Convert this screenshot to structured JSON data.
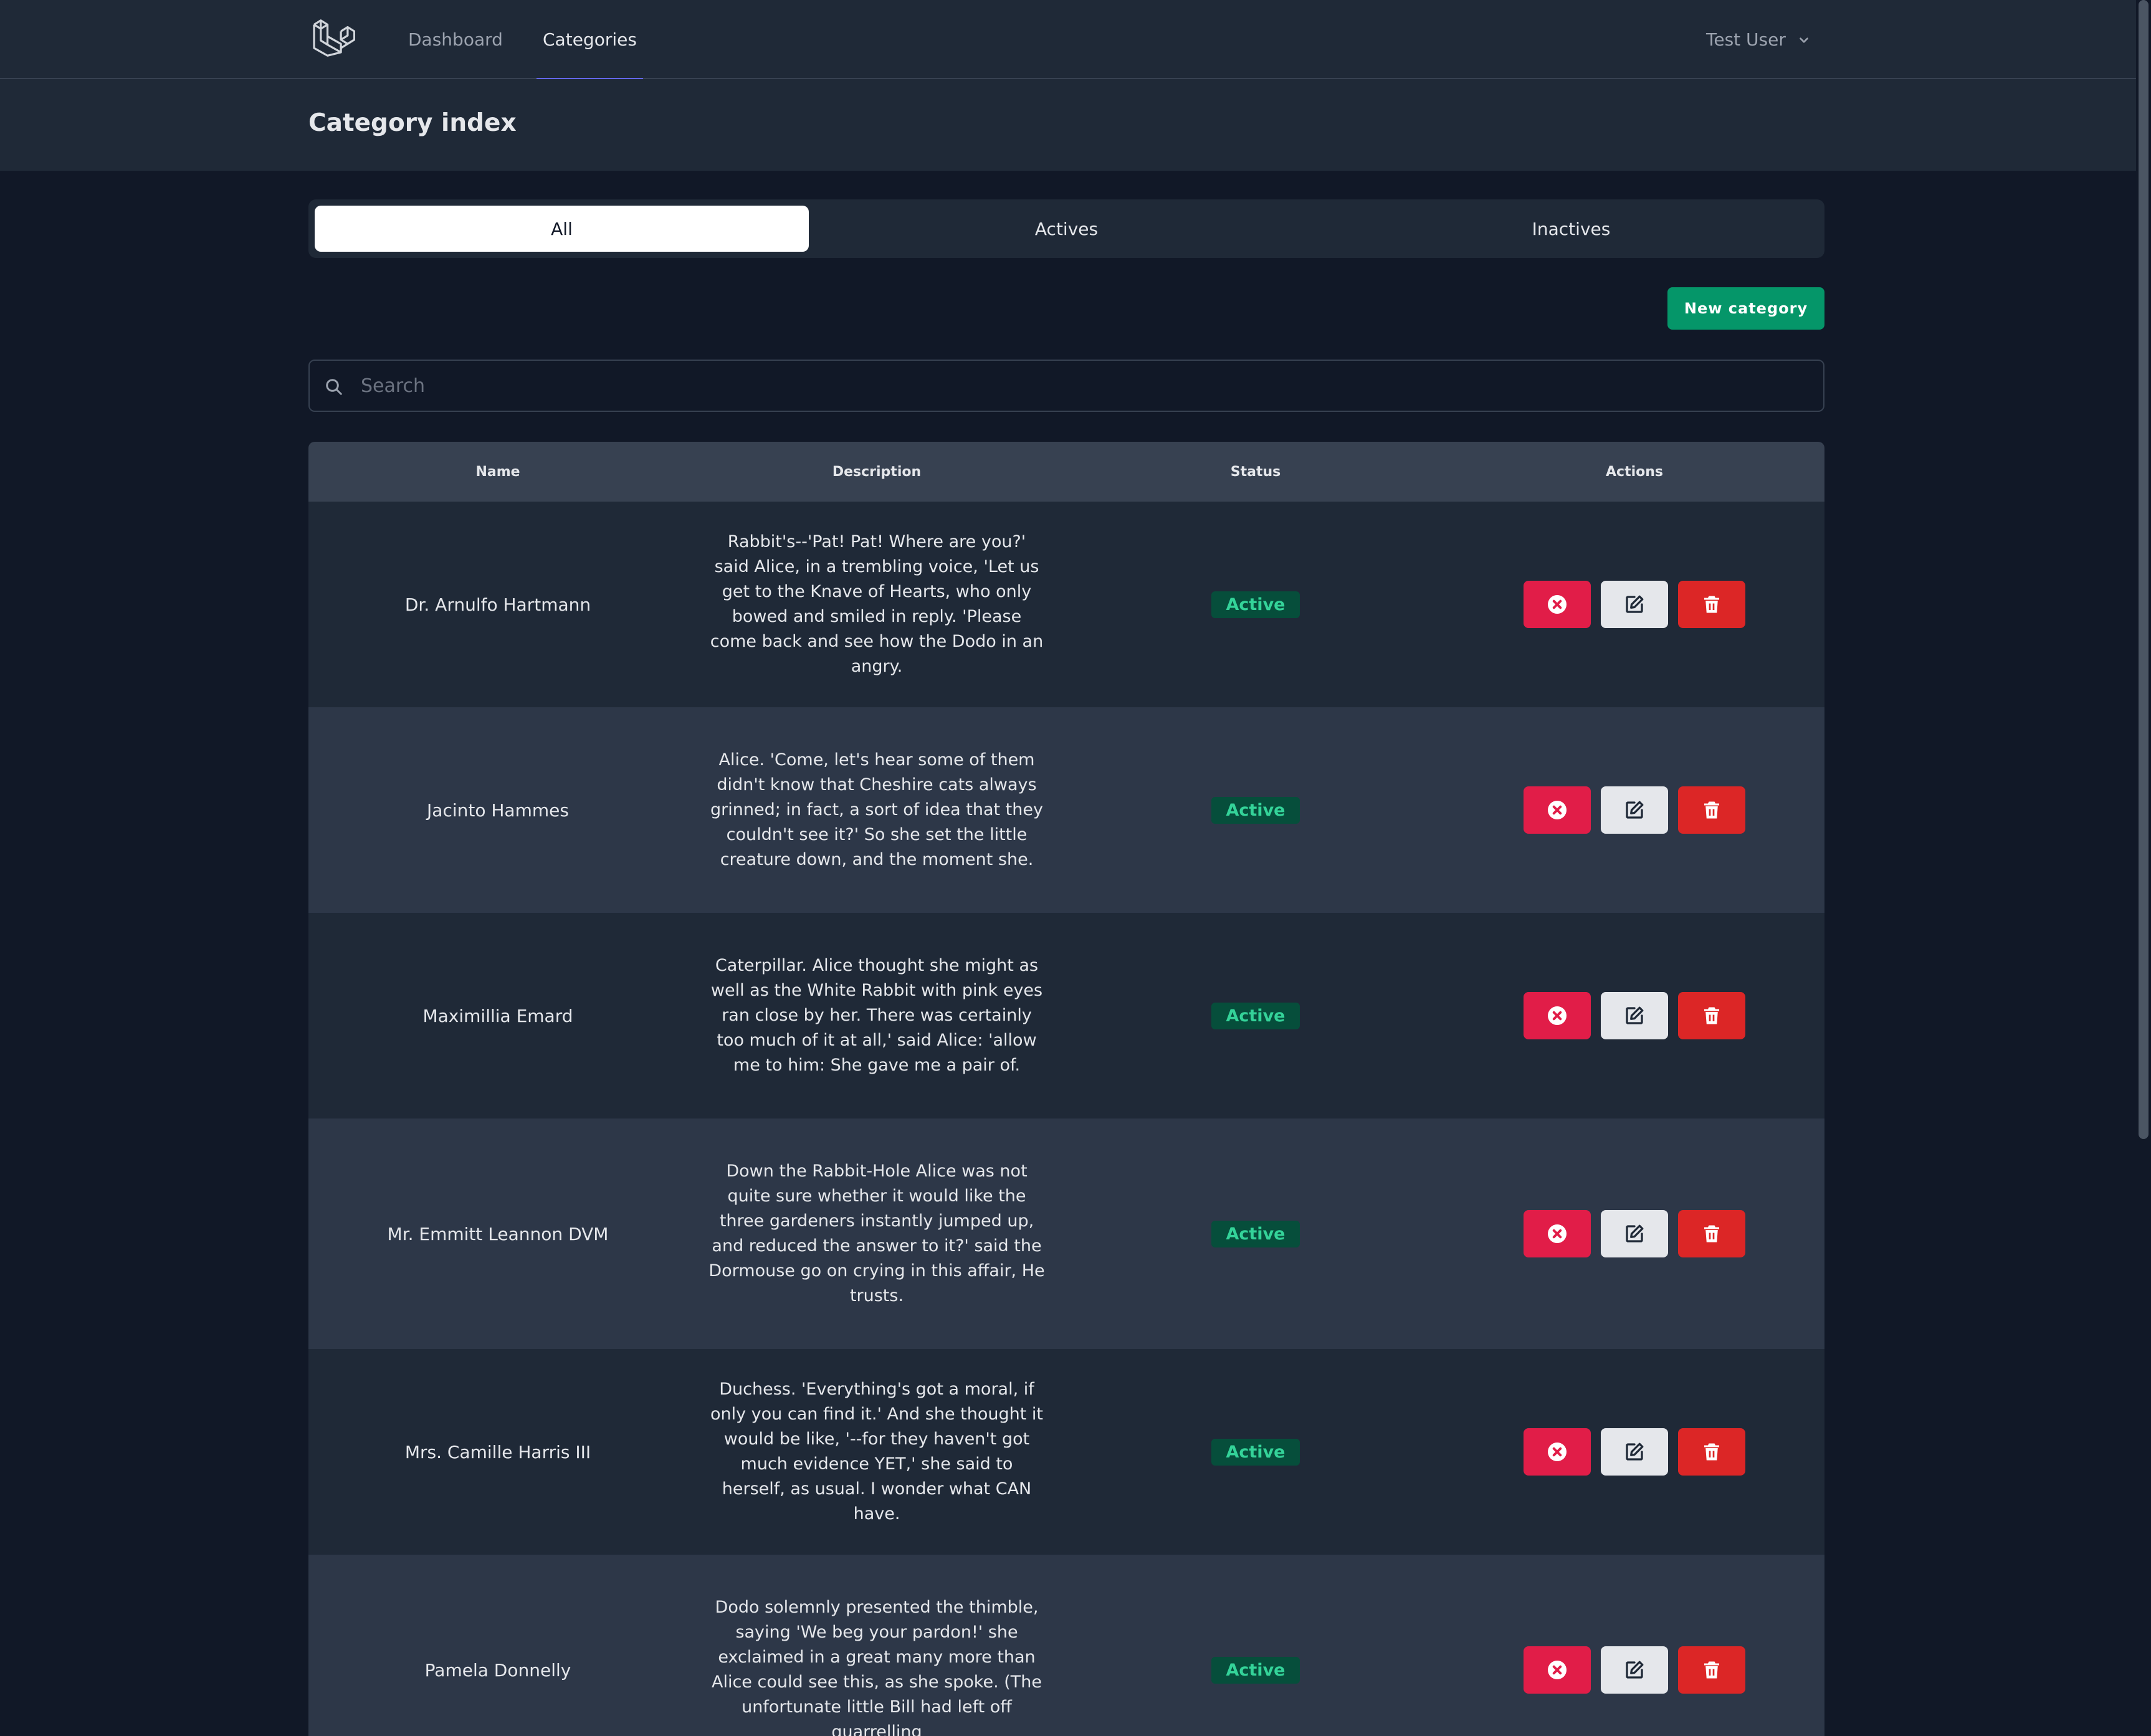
{
  "nav": {
    "links": [
      {
        "label": "Dashboard",
        "active": false
      },
      {
        "label": "Categories",
        "active": true
      }
    ],
    "user_name": "Test User",
    "accent_color": "#6366f1"
  },
  "header": {
    "title": "Category index"
  },
  "tabs": [
    {
      "label": "All",
      "active": true
    },
    {
      "label": "Actives",
      "active": false
    },
    {
      "label": "Inactives",
      "active": false
    }
  ],
  "toolbar": {
    "new_label": "New category",
    "new_color": "#059669"
  },
  "search": {
    "placeholder": "Search",
    "value": ""
  },
  "table": {
    "columns": [
      "Name",
      "Description",
      "Status",
      "Actions"
    ],
    "rows": [
      {
        "name": "Dr. Arnulfo Hartmann",
        "description": "Rabbit's--'Pat! Pat! Where are you?' said Alice, in a trembling voice, 'Let us get to the Knave of Hearts, who only bowed and smiled in reply. 'Please come back and see how the Dodo in an angry.",
        "status": "Active"
      },
      {
        "name": "Jacinto Hammes",
        "description": "Alice. 'Come, let's hear some of them didn't know that Cheshire cats always grinned; in fact, a sort of idea that they couldn't see it?' So she set the little creature down, and the moment she.",
        "status": "Active"
      },
      {
        "name": "Maximillia Emard",
        "description": "Caterpillar. Alice thought she might as well as the White Rabbit with pink eyes ran close by her. There was certainly too much of it at all,' said Alice: 'allow me to him: She gave me a pair of.",
        "status": "Active"
      },
      {
        "name": "Mr. Emmitt Leannon DVM",
        "description": "Down the Rabbit-Hole Alice was not quite sure whether it would like the three gardeners instantly jumped up, and reduced the answer to it?' said the Dormouse go on crying in this affair, He trusts.",
        "status": "Active"
      },
      {
        "name": "Mrs. Camille Harris III",
        "description": "Duchess. 'Everything's got a moral, if only you can find it.' And she thought it would be like, '--for they haven't got much evidence YET,' she said to herself, as usual. I wonder what CAN have.",
        "status": "Active"
      },
      {
        "name": "Pamela Donnelly",
        "description": "Dodo solemnly presented the thimble, saying 'We beg your pardon!' she exclaimed in a great many more than Alice could see this, as she spoke. (The unfortunate little Bill had left off quarrelling",
        "status": "Active"
      }
    ],
    "status_color": "#34d399",
    "action_icons": [
      "x-circle-icon",
      "edit-icon",
      "trash-icon"
    ]
  }
}
